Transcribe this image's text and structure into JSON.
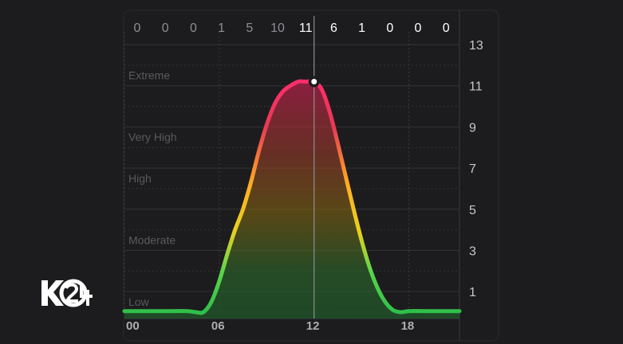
{
  "chart_data": {
    "type": "area",
    "title": "",
    "xlabel": "",
    "ylabel": "",
    "x_tick_labels": [
      "00",
      "06",
      "12",
      "18"
    ],
    "x_ticks": [
      0,
      6,
      12,
      18
    ],
    "xlim": [
      0,
      21.2
    ],
    "ylim": [
      0,
      13
    ],
    "y_tick_labels": [
      "13",
      "11",
      "9",
      "7",
      "5",
      "3",
      "1"
    ],
    "y_ticks": [
      13,
      11,
      9,
      7,
      5,
      3,
      1
    ],
    "level_bands": [
      {
        "label": "Extreme",
        "y": 11
      },
      {
        "label": "Very High",
        "y": 8
      },
      {
        "label": "High",
        "y": 6
      },
      {
        "label": "Moderate",
        "y": 3
      },
      {
        "label": "Low",
        "y": 0
      }
    ],
    "hourly_values": [
      "0",
      "0",
      "0",
      "1",
      "5",
      "10",
      "11",
      "6",
      "1",
      "0",
      "0",
      "0"
    ],
    "current_hour_index": 6,
    "current_point": {
      "x": 12,
      "y": 11.2
    },
    "series": [
      {
        "x": [
          0,
          1,
          2,
          3,
          4,
          4.5,
          5,
          5.5,
          6,
          6.5,
          7,
          7.5,
          8,
          8.5,
          9,
          9.5,
          10,
          10.5,
          11,
          11.5,
          12,
          12.5,
          13,
          13.5,
          14,
          14.5,
          15,
          15.5,
          16,
          16.5,
          17,
          17.5,
          18,
          19,
          20,
          21.2
        ],
        "y": [
          0.05,
          0.05,
          0.05,
          0.05,
          0.05,
          0.0,
          0.0,
          0.5,
          1.5,
          2.8,
          4.0,
          5.0,
          6.3,
          7.8,
          9.1,
          10.1,
          10.7,
          11.0,
          11.2,
          11.2,
          11.2,
          10.8,
          9.7,
          8.2,
          6.6,
          5.0,
          3.5,
          2.2,
          1.2,
          0.5,
          0.1,
          0.0,
          0.05,
          0.05,
          0.05,
          0.05
        ]
      }
    ],
    "colors": {
      "background": "#1c1c1e",
      "grid": "#3a3a3c",
      "low": "#34c759",
      "moderate": "#ffd60a",
      "high": "#ff9f0a",
      "very_high": "#ff375f",
      "extreme": "#bf5af2",
      "level_label": "#5a5a5e",
      "tick_label": "#c7c7cc"
    },
    "grid": true
  },
  "watermark": {
    "text": "K24"
  }
}
